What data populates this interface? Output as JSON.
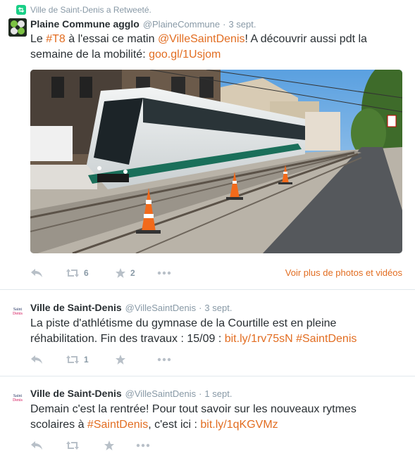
{
  "retweet_context": {
    "text": "Ville de Saint-Denis a Retweeté.",
    "icon": "retweet-badge-icon"
  },
  "tweets": [
    {
      "fullname": "Plaine Commune agglo",
      "username": "@PlaineCommune",
      "separator": "·",
      "time": "3 sept.",
      "avatar": "plaine-commune-logo",
      "text_parts": [
        {
          "t": "Le ",
          "k": "plain"
        },
        {
          "t": "#T8",
          "k": "hash"
        },
        {
          "t": " à l'essai ce matin ",
          "k": "plain"
        },
        {
          "t": "@VilleSaintDenis",
          "k": "mention"
        },
        {
          "t": "! A découvrir aussi pdt la semaine de la mobilité: ",
          "k": "plain"
        },
        {
          "t": "goo.gl/1Usjom",
          "k": "link"
        }
      ],
      "media": "tram-photo",
      "actions": {
        "reply_icon": "reply-icon",
        "retweet_icon": "retweet-icon",
        "retweets": "6",
        "favorite_icon": "star-icon",
        "favorites": "2",
        "more_icon": "more-icon"
      },
      "media_link": "Voir plus de photos et vidéos"
    },
    {
      "fullname": "Ville de Saint-Denis",
      "username": "@VilleSaintDenis",
      "separator": "·",
      "time": "3 sept.",
      "avatar": "saint-denis-logo",
      "avatar_lines": [
        "Saint",
        "Denis"
      ],
      "text_parts": [
        {
          "t": "La piste d'athlétisme du gymnase de la Courtille est en pleine réhabilitation. Fin des travaux : 15/09 : ",
          "k": "plain"
        },
        {
          "t": "bit.ly/1rv75sN",
          "k": "link"
        },
        {
          "t": " ",
          "k": "plain"
        },
        {
          "t": "#SaintDenis",
          "k": "hash"
        }
      ],
      "actions": {
        "reply_icon": "reply-icon",
        "retweet_icon": "retweet-icon",
        "retweets": "1",
        "favorite_icon": "star-icon",
        "favorites": "",
        "more_icon": "more-icon"
      }
    },
    {
      "fullname": "Ville de Saint-Denis",
      "username": "@VilleSaintDenis",
      "separator": "·",
      "time": "1 sept.",
      "avatar": "saint-denis-logo",
      "avatar_lines": [
        "Saint",
        "Denis"
      ],
      "text_parts": [
        {
          "t": "Demain c'est la rentrée! Pour tout savoir sur les nouveaux rytmes scolaires à ",
          "k": "plain"
        },
        {
          "t": "#SaintDenis",
          "k": "hash"
        },
        {
          "t": ", c'est ici : ",
          "k": "plain"
        },
        {
          "t": "bit.ly/1qKGVMz",
          "k": "link"
        }
      ],
      "actions": {
        "reply_icon": "reply-icon",
        "retweet_icon": "retweet-icon",
        "retweets": "",
        "favorite_icon": "star-icon",
        "favorites": "",
        "more_icon": "more-icon"
      }
    }
  ],
  "colors": {
    "link": "#e26d21",
    "muted": "#8899a6",
    "text": "#292f33",
    "action_icon": "#b8c0c8",
    "retweet_badge": "#19cf86"
  }
}
